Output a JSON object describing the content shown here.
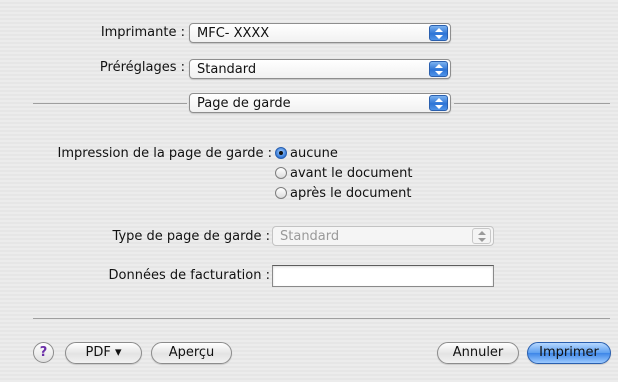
{
  "printer": {
    "label": "Imprimante :",
    "value": "MFC- XXXX"
  },
  "presets": {
    "label": "Préréglages :",
    "value": "Standard"
  },
  "panel": {
    "value": "Page de garde"
  },
  "cover_page": {
    "label": "Impression de la page de garde :",
    "options": [
      {
        "label": "aucune",
        "selected": true
      },
      {
        "label": "avant le document",
        "selected": false
      },
      {
        "label": "après le document",
        "selected": false
      }
    ]
  },
  "cover_type": {
    "label": "Type de page de garde :",
    "value": "Standard"
  },
  "billing": {
    "label": "Données de facturation :",
    "value": ""
  },
  "footer": {
    "help_label": "?",
    "pdf_label": "PDF ▾",
    "preview_label": "Aperçu",
    "cancel_label": "Annuler",
    "print_label": "Imprimer"
  },
  "colors": {
    "accent": "#3d86e8",
    "window_bg": "#e9e9e9"
  },
  "icons": {
    "popup_arrows": "up-down-arrows-icon",
    "radio": "radio-button-icon"
  }
}
